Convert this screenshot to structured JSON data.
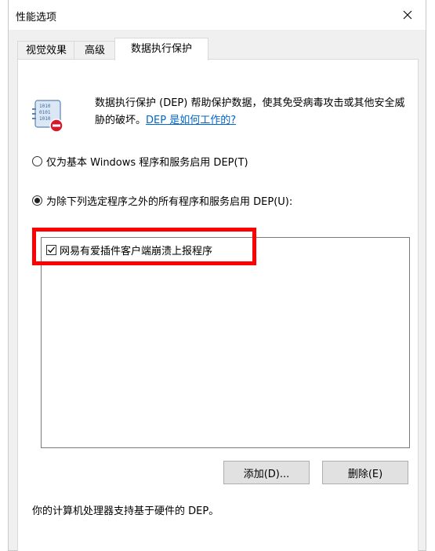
{
  "window": {
    "title": "性能选项",
    "close_icon": "close-icon"
  },
  "tabs": [
    {
      "label": "视觉效果",
      "active": false
    },
    {
      "label": "高级",
      "active": false
    },
    {
      "label": "数据执行保护",
      "active": true
    }
  ],
  "dep": {
    "icon": "dep-shield-binary-icon",
    "description": "数据执行保护 (DEP) 帮助保护数据，使其免受病毒攻击或其他安全威胁的破坏。",
    "help_link": "DEP 是如何工作的?"
  },
  "options": {
    "basic_label": "仅为基本 Windows 程序和服务启用 DEP(T)",
    "basic_selected": false,
    "all_except_label": "为除下列选定程序之外的所有程序和服务启用 DEP(U):",
    "all_except_selected": true
  },
  "program_list": [
    {
      "label": "网易有爱插件客户端崩溃上报程序",
      "checked": true
    }
  ],
  "buttons": {
    "add_label": "添加(D)...",
    "remove_label": "删除(E)"
  },
  "footer": {
    "note": "你的计算机处理器支持基于硬件的 DEP。"
  },
  "colors": {
    "highlight": "#ff0000",
    "link": "#0066cc"
  }
}
